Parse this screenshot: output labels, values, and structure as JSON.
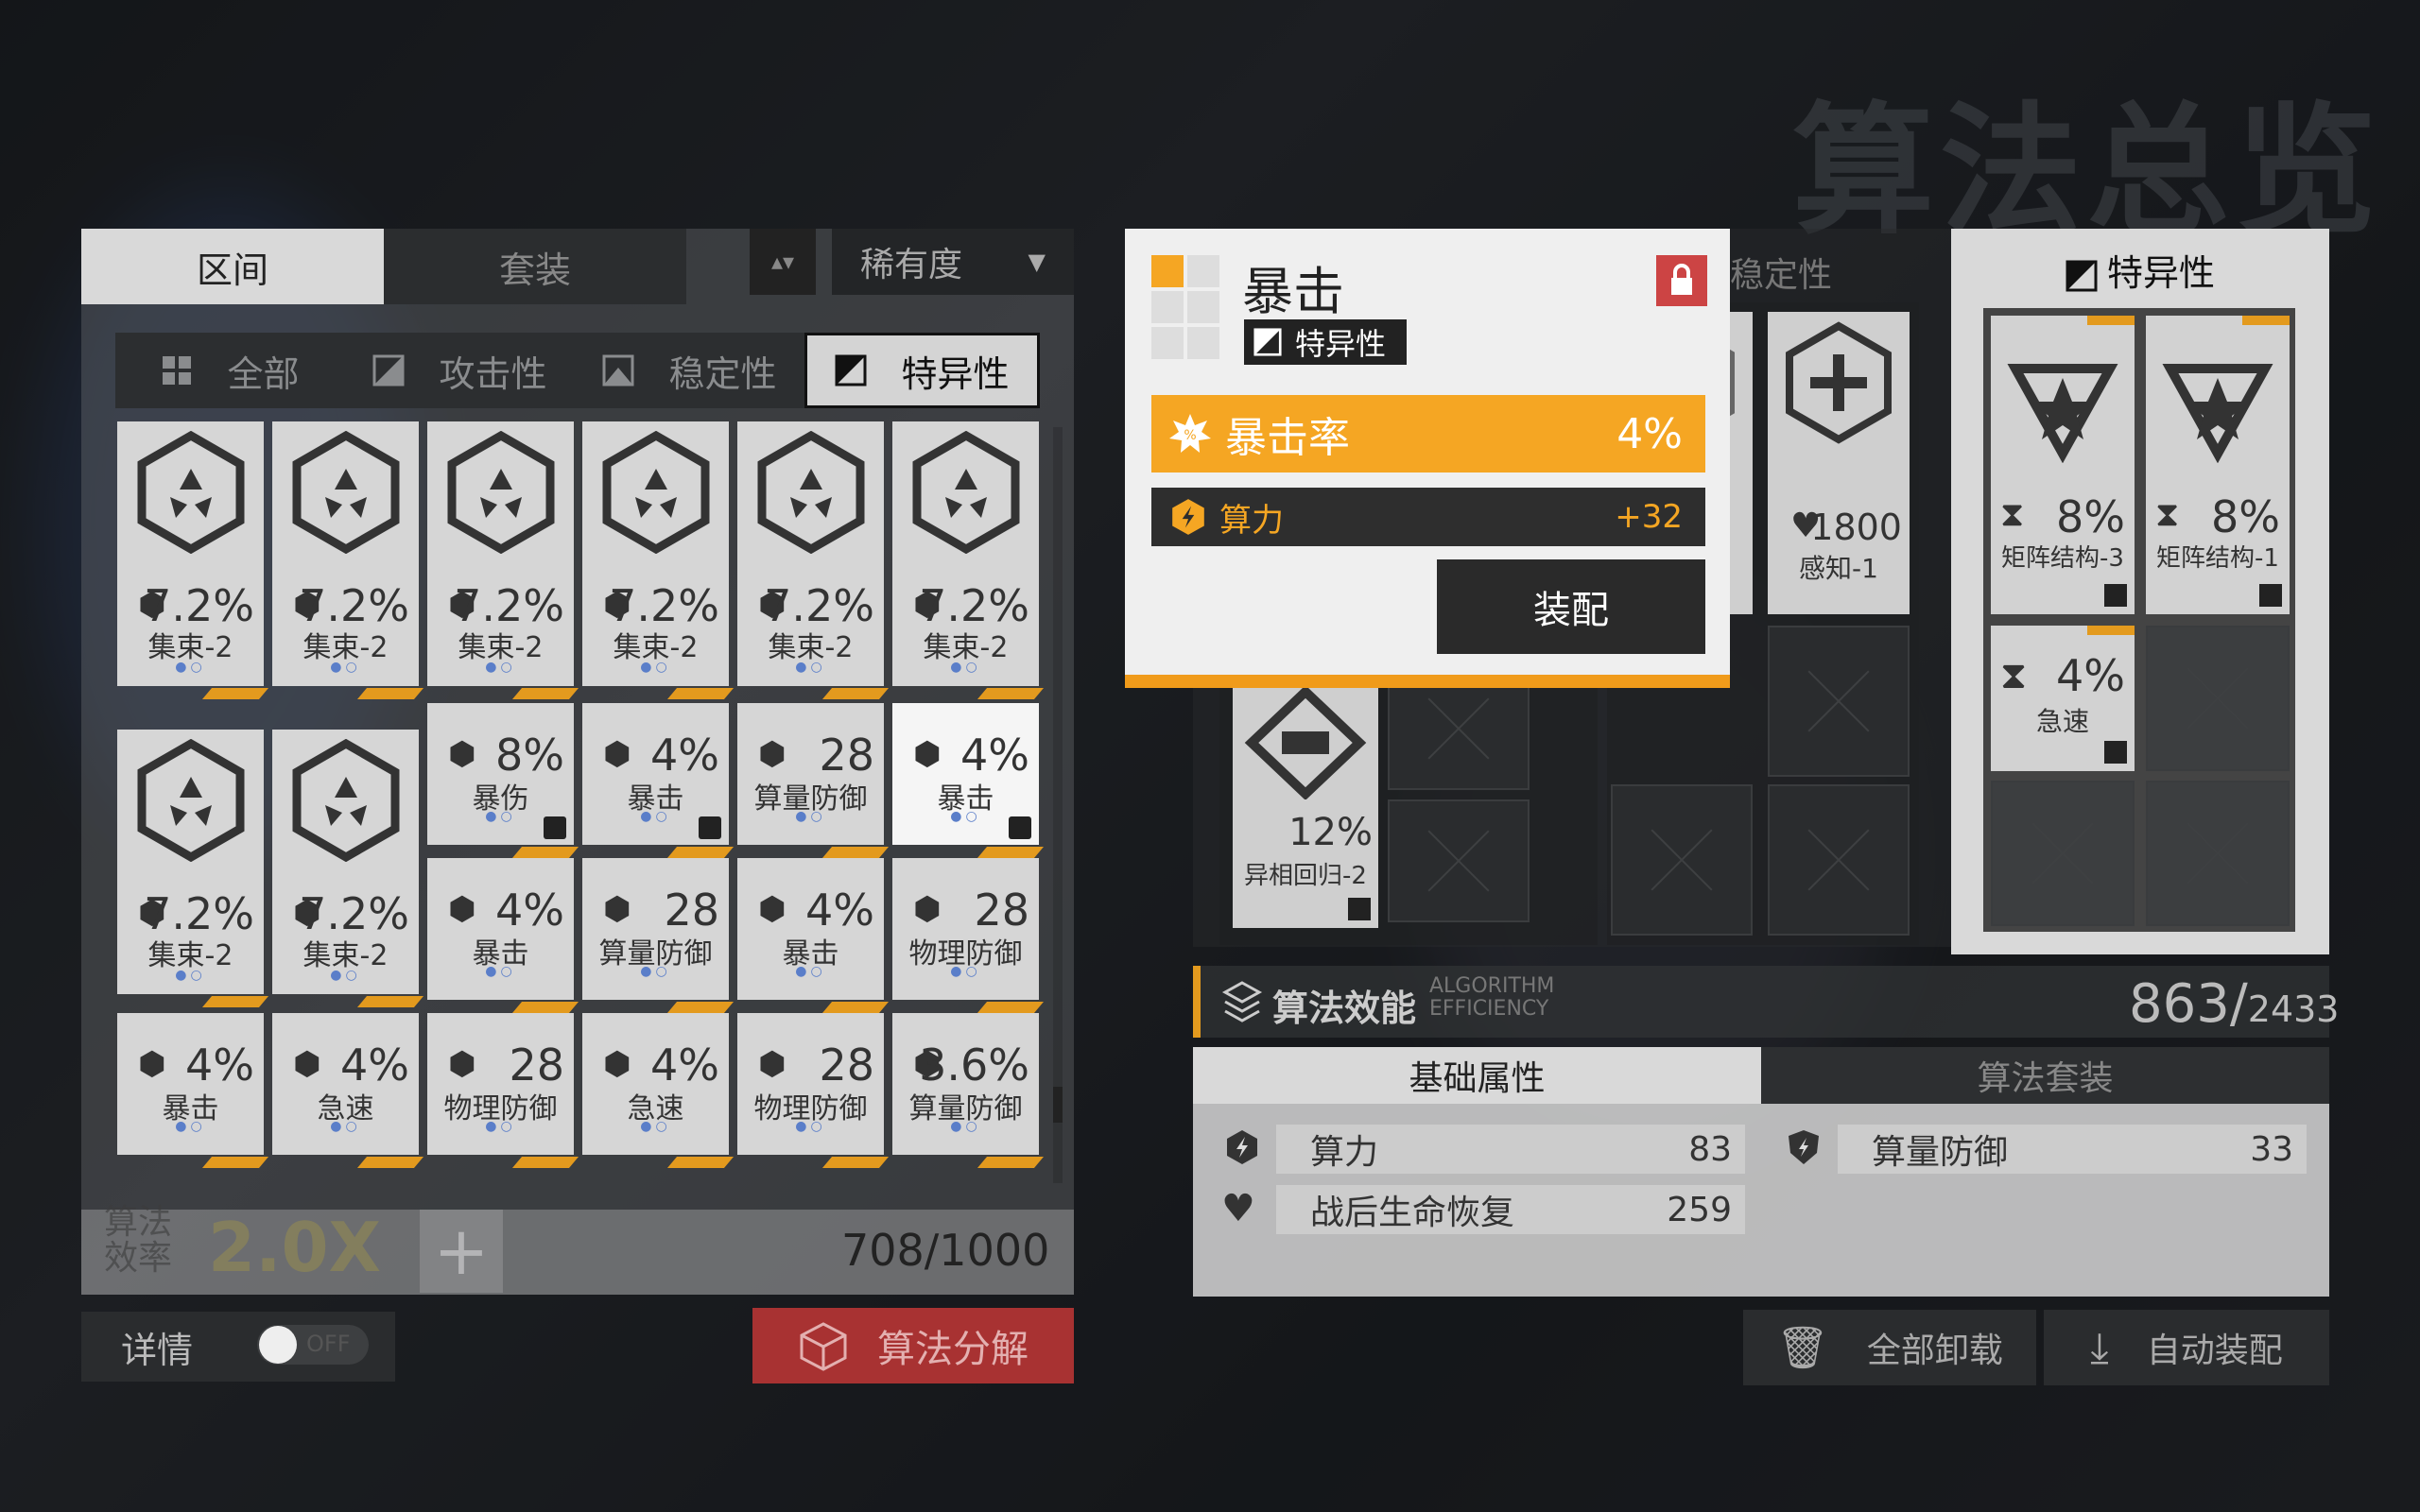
{
  "header": {
    "title": "算法总览"
  },
  "left": {
    "tabs": [
      "区间",
      "套装"
    ],
    "sort_label": "稀有度",
    "filters": [
      "全部",
      "攻击性",
      "稳定性",
      "特异性"
    ],
    "cards": [
      {
        "v": "7.2%",
        "n": "集束-2"
      },
      {
        "v": "7.2%",
        "n": "集束-2"
      },
      {
        "v": "7.2%",
        "n": "集束-2"
      },
      {
        "v": "7.2%",
        "n": "集束-2"
      },
      {
        "v": "7.2%",
        "n": "集束-2"
      },
      {
        "v": "7.2%",
        "n": "集束-2"
      },
      {
        "v": "7.2%",
        "n": "集束-2"
      },
      {
        "v": "7.2%",
        "n": "集束-2"
      },
      {
        "v": "8%",
        "n": "暴伤"
      },
      {
        "v": "4%",
        "n": "暴击"
      },
      {
        "v": "28",
        "n": "算量防御"
      },
      {
        "v": "4%",
        "n": "暴击"
      },
      {
        "v": "4%",
        "n": "暴击"
      },
      {
        "v": "28",
        "n": "算量防御"
      },
      {
        "v": "4%",
        "n": "暴击"
      },
      {
        "v": "28",
        "n": "物理防御"
      },
      {
        "v": "4%",
        "n": "暴击"
      },
      {
        "v": "4%",
        "n": "急速"
      },
      {
        "v": "28",
        "n": "物理防御"
      },
      {
        "v": "4%",
        "n": "急速"
      },
      {
        "v": "28",
        "n": "物理防御"
      },
      {
        "v": "3.6%",
        "n": "算量防御"
      }
    ],
    "efficiency_label": "算法效率",
    "efficiency_value": "2.0X",
    "plus": "+",
    "capacity": "708/1000",
    "detail_label": "详情",
    "toggle_text": "OFF",
    "decompose_label": "算法分解"
  },
  "right": {
    "stability_tab": "稳定性",
    "specificity_tab": "特异性",
    "slot_cards": [
      {
        "v": "1800",
        "n": "感知-1"
      },
      {
        "v": "12%",
        "n": "异相回归-2"
      }
    ],
    "spec_cards": [
      {
        "v": "8%",
        "n": "矩阵结构-3"
      },
      {
        "v": "8%",
        "n": "矩阵结构-1"
      },
      {
        "v": "4%",
        "n": "急速"
      }
    ],
    "efficiency_title": "算法效能",
    "efficiency_sub1": "ALGORITHM",
    "efficiency_sub2": "EFFICIENCY",
    "efficiency_value": "863/",
    "efficiency_max": "2433",
    "attr_tabs": [
      "基础属性",
      "算法套装"
    ],
    "attrs": [
      {
        "label": "算力",
        "value": "83"
      },
      {
        "label": "算量防御",
        "value": "33"
      },
      {
        "label": "战后生命恢复",
        "value": "259"
      }
    ],
    "unequip_all": "全部卸载",
    "auto_equip": "自动装配"
  },
  "popup": {
    "title": "暴击",
    "tag": "特异性",
    "main_stat": "暴击率",
    "main_value": "4%",
    "sub_stat": "算力",
    "sub_value": "+32",
    "equip_label": "装配"
  },
  "colors": {
    "accent": "#f5a623",
    "danger": "#a83232"
  }
}
